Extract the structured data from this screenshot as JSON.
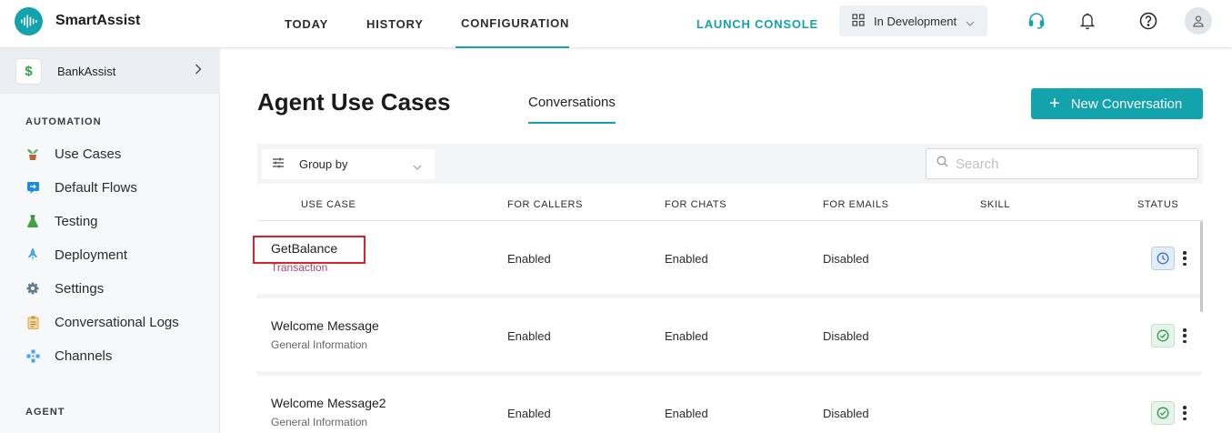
{
  "app": {
    "brand": "SmartAssist",
    "nav": [
      {
        "label": "TODAY"
      },
      {
        "label": "HISTORY"
      },
      {
        "label": "CONFIGURATION"
      }
    ],
    "launch_console": "LAUNCH CONSOLE",
    "environment": "In Development",
    "accent_color": "#13a3ad"
  },
  "sidebar": {
    "bot_name": "BankAssist",
    "bot_icon": "$",
    "sections": {
      "automation": "AUTOMATION",
      "agent": "AGENT"
    },
    "items": [
      {
        "label": "Use Cases",
        "icon": "plant-icon"
      },
      {
        "label": "Default Flows",
        "icon": "flow-icon"
      },
      {
        "label": "Testing",
        "icon": "flask-icon"
      },
      {
        "label": "Deployment",
        "icon": "rocket-icon"
      },
      {
        "label": "Settings",
        "icon": "gear-icon"
      },
      {
        "label": "Conversational Logs",
        "icon": "clipboard-icon"
      },
      {
        "label": "Channels",
        "icon": "channels-icon"
      }
    ]
  },
  "main": {
    "title": "Agent Use Cases",
    "tab": "Conversations",
    "new_button": "New Conversation",
    "group_by": "Group by",
    "search_placeholder": "Search",
    "columns": [
      "USE CASE",
      "FOR CALLERS",
      "FOR CHATS",
      "FOR EMAILS",
      "SKILL",
      "STATUS"
    ],
    "rows": [
      {
        "name": "GetBalance",
        "type": "Transaction",
        "callers": "Enabled",
        "chats": "Enabled",
        "emails": "Disabled",
        "skill": "",
        "status": "pending"
      },
      {
        "name": "Welcome Message",
        "type": "General Information",
        "callers": "Enabled",
        "chats": "Enabled",
        "emails": "Disabled",
        "skill": "",
        "status": "published"
      },
      {
        "name": "Welcome Message2",
        "type": "General Information",
        "callers": "Enabled",
        "chats": "Enabled",
        "emails": "Disabled",
        "skill": "",
        "status": "published"
      }
    ]
  }
}
